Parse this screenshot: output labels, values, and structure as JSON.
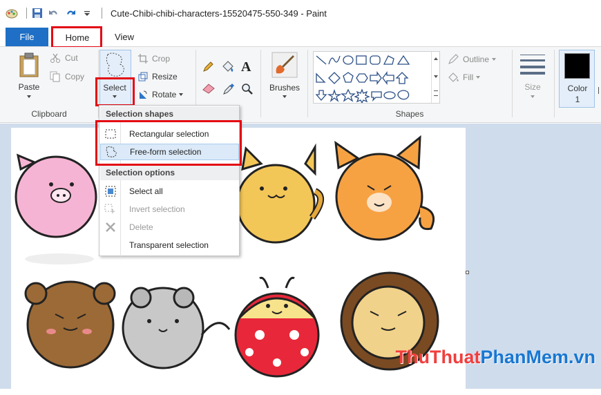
{
  "window": {
    "title": "Cute-Chibi-chibi-characters-15520475-550-349 - Paint"
  },
  "tabs": {
    "file": "File",
    "home": "Home",
    "view": "View"
  },
  "clipboard": {
    "paste": "Paste",
    "cut": "Cut",
    "copy": "Copy",
    "group_label": "Clipboard"
  },
  "image": {
    "select": "Select",
    "crop": "Crop",
    "resize": "Resize",
    "rotate": "Rotate"
  },
  "tools": {
    "brushes": "Brushes"
  },
  "shapes": {
    "outline": "Outline",
    "fill": "Fill",
    "group_label": "Shapes"
  },
  "size": {
    "label": "Size"
  },
  "color": {
    "label": "Color",
    "number": "1",
    "value": "#000000"
  },
  "select_menu": {
    "shapes_header": "Selection shapes",
    "rectangular": "Rectangular selection",
    "freeform": "Free-form selection",
    "options_header": "Selection options",
    "select_all": "Select all",
    "invert": "Invert selection",
    "delete": "Delete",
    "transparent": "Transparent selection"
  },
  "watermark": {
    "part1": "ThuThuat",
    "part2": "PhanMem",
    "part3": ".vn"
  },
  "colors": {
    "file_tab": "#1e6fc5",
    "highlight": "#e30613",
    "workspace": "#cfdcec"
  }
}
